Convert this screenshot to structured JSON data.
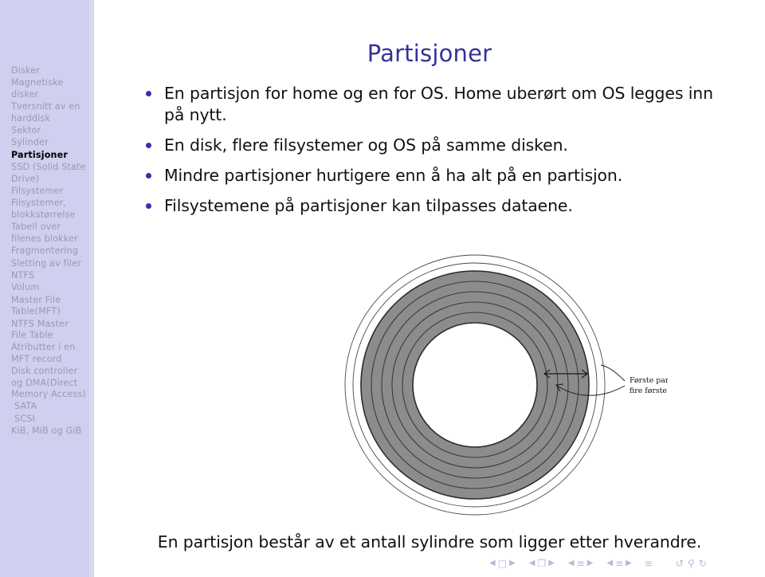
{
  "slide": {
    "title": "Partisjoner",
    "title_color": "#33339a",
    "background_color": "#ffffff"
  },
  "sidebar": {
    "background_color": "#cfcfef",
    "inactive_text_color": "#9a9ab4",
    "active_text_color": "#000000",
    "items": [
      {
        "label": "Disker",
        "current": false,
        "indent": false
      },
      {
        "label": "Magnetiske disker",
        "current": false,
        "indent": false
      },
      {
        "label": "Tversnitt av en harddisk",
        "current": false,
        "indent": false
      },
      {
        "label": "Sektor",
        "current": false,
        "indent": false
      },
      {
        "label": "Sylinder",
        "current": false,
        "indent": false
      },
      {
        "label": "Partisjoner",
        "current": true,
        "indent": false
      },
      {
        "label": "SSD (Solid State Drive)",
        "current": false,
        "indent": false
      },
      {
        "label": "Filsystemer",
        "current": false,
        "indent": false
      },
      {
        "label": "Filsystemer, blokkstørrelse",
        "current": false,
        "indent": false
      },
      {
        "label": "Tabell over filenes blokker",
        "current": false,
        "indent": false
      },
      {
        "label": "Fragmentering",
        "current": false,
        "indent": false
      },
      {
        "label": "Sletting av filer",
        "current": false,
        "indent": false
      },
      {
        "label": "NTFS",
        "current": false,
        "indent": false
      },
      {
        "label": "Volum",
        "current": false,
        "indent": false
      },
      {
        "label": "Master File Table(MFT)",
        "current": false,
        "indent": false
      },
      {
        "label": "NTFS Master File Table",
        "current": false,
        "indent": false
      },
      {
        "label": "Atributter i en MFT record",
        "current": false,
        "indent": false
      },
      {
        "label": "Disk controller og DMA(Direct Memory Access)",
        "current": false,
        "indent": false
      },
      {
        "label": "SATA",
        "current": false,
        "indent": true
      },
      {
        "label": "SCSI",
        "current": false,
        "indent": true
      },
      {
        "label": "KiB, MiB og GiB",
        "current": false,
        "indent": false
      }
    ]
  },
  "content": {
    "bullet_color": "#3333a8",
    "bullets": [
      "En partisjon for home og en for OS. Home uberørt om OS legges inn på nytt.",
      "En disk, flere filsystemer og OS på samme disken.",
      "Mindre partisjoner hurtigere enn å ha alt på en partisjon.",
      "Filsystemene på partisjoner kan tilpasses dataene."
    ],
    "bottom_caption": "En partisjon består av et antall sylindre som ligger etter hverandre."
  },
  "diagram": {
    "name": "disk-platter-cylinders",
    "annotation_line1": "Første partisjon er her de",
    "annotation_line2": "fire første sylinderene.",
    "ring_fill_color": "#8c8c8c",
    "ring_stroke_color": "#2b2b2b",
    "hub_fill_color": "#ffffff",
    "radii": [
      163,
      153,
      143,
      130,
      117,
      104,
      91,
      78
    ],
    "shaded_outer_radius": 143,
    "shaded_inner_radius": 78,
    "cylinder_count": 5,
    "highlighted_cylinders": 4
  },
  "navigation": {
    "symbols": [
      "prev-slide",
      "slide-icon",
      "next-slide",
      "prev-frame",
      "frame-icon",
      "next-frame",
      "prev-subsection",
      "subsection-icon",
      "next-subsection",
      "prev-section",
      "section-icon",
      "next-section",
      "document-icon",
      "back-icon",
      "search-icon",
      "forward-icon"
    ],
    "color": "#b9b9d4"
  }
}
